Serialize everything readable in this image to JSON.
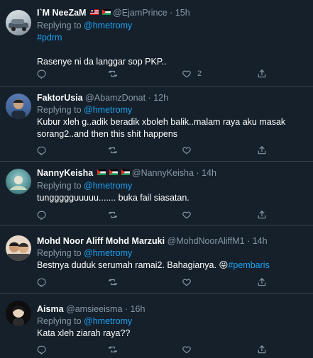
{
  "tweets": [
    {
      "display_name": "I`M NeeZaM",
      "handle": "@EjamPrince",
      "separator": "·",
      "time": "15h",
      "replying_prefix": "Replying to",
      "replying_to": "@hmetromy",
      "hashtag": "#pdrm",
      "text": "Rasenye ni da langgar sop PKP..",
      "like_count": "2"
    },
    {
      "display_name": "FaktorUsia",
      "handle": "@AbamzDonat",
      "separator": "·",
      "time": "12h",
      "replying_prefix": "Replying to",
      "replying_to": "@hmetromy",
      "text_line1": "Kubur xleh g..adik beradik xboleh balik..malam raya aku masak",
      "text_line2": "sorang2..and then this shit happens"
    },
    {
      "display_name": "NannyKeisha",
      "handle": "@NannyKeisha",
      "separator": "·",
      "time": "14h",
      "replying_prefix": "Replying to",
      "replying_to": "@hmetromy",
      "text": "tunggggguuuuu....... buka fail siasatan."
    },
    {
      "display_name": "Mohd Noor Aliff Mohd Marzuki",
      "handle": "@MohdNoorAliffM1",
      "separator": "·",
      "time": "14h",
      "replying_prefix": "Replying to",
      "replying_to": "@hmetromy",
      "text": "Bestnya duduk serumah ramai2. Bahagianya.",
      "emoji": "😝",
      "hashtag": "#pembaris"
    },
    {
      "display_name": "Aisma",
      "handle": "@amsieeisma",
      "separator": "·",
      "time": "16h",
      "replying_prefix": "Replying to",
      "replying_to": "@hmetromy",
      "text": "Kata xleh ziarah raya??"
    }
  ],
  "icons": [
    "reply-icon",
    "retweet-icon",
    "like-icon",
    "share-icon"
  ],
  "colors": {
    "background": "#15202b",
    "secondary_text": "#8899a6",
    "link": "#1da1f2",
    "divider": "#38444d"
  }
}
